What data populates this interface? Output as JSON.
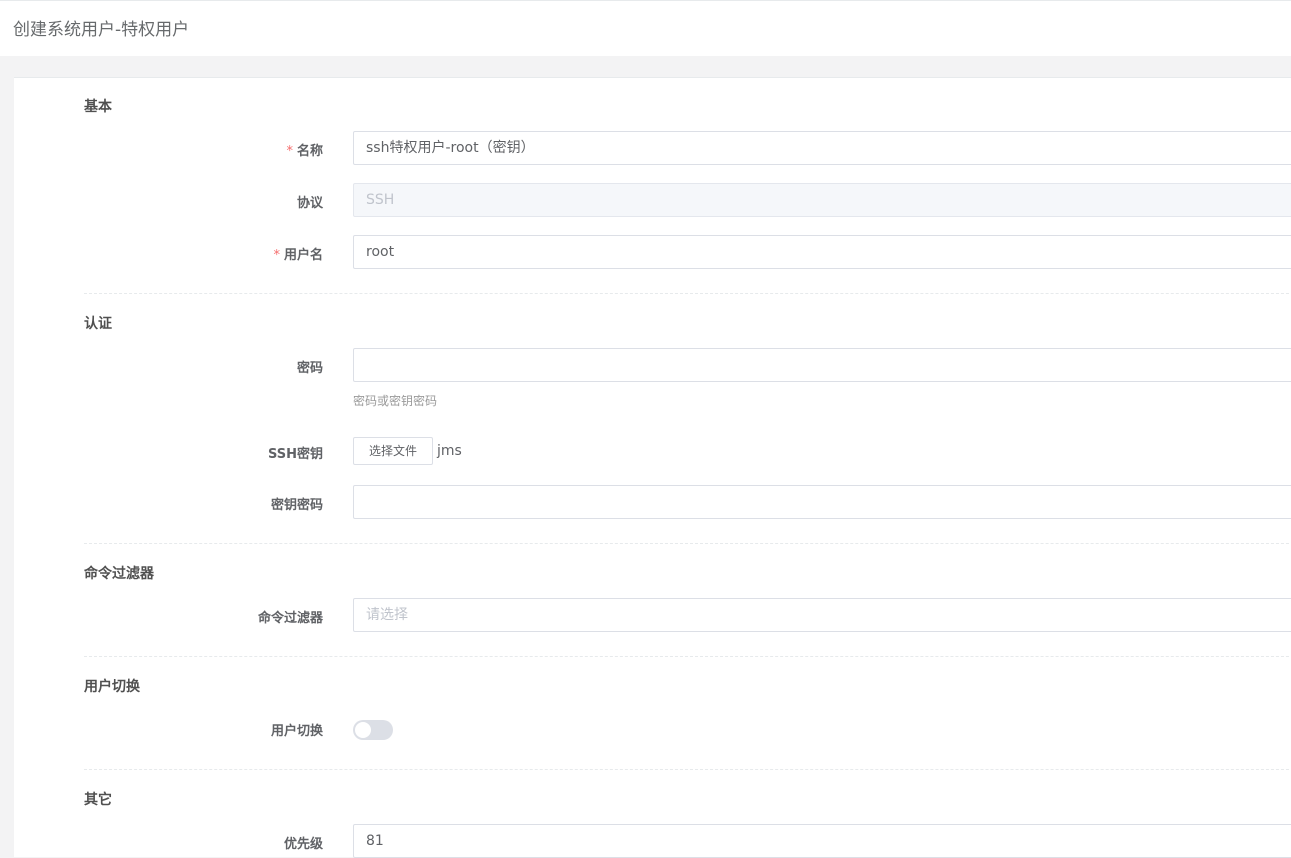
{
  "page": {
    "title": "创建系统用户-特权用户"
  },
  "sections": {
    "basic": "基本",
    "auth": "认证",
    "command_filter": "命令过滤器",
    "su": "用户切换",
    "other": "其它"
  },
  "fields": {
    "name": {
      "label": "名称",
      "required_mark": "*",
      "value": "ssh特权用户-root（密钥）"
    },
    "protocol": {
      "label": "协议",
      "value": "SSH"
    },
    "username": {
      "label": "用户名",
      "required_mark": "*",
      "value": "root"
    },
    "password": {
      "label": "密码",
      "value": "",
      "help": "密码或密钥密码"
    },
    "ssh_key": {
      "label": "SSH密钥",
      "button": "选择文件",
      "file_name": "jms"
    },
    "passphrase": {
      "label": "密钥密码",
      "value": ""
    },
    "cmd_filters": {
      "label": "命令过滤器",
      "placeholder": "请选择"
    },
    "su_enabled": {
      "label": "用户切换",
      "enabled": false
    },
    "priority": {
      "label": "优先级",
      "value": "81"
    }
  }
}
